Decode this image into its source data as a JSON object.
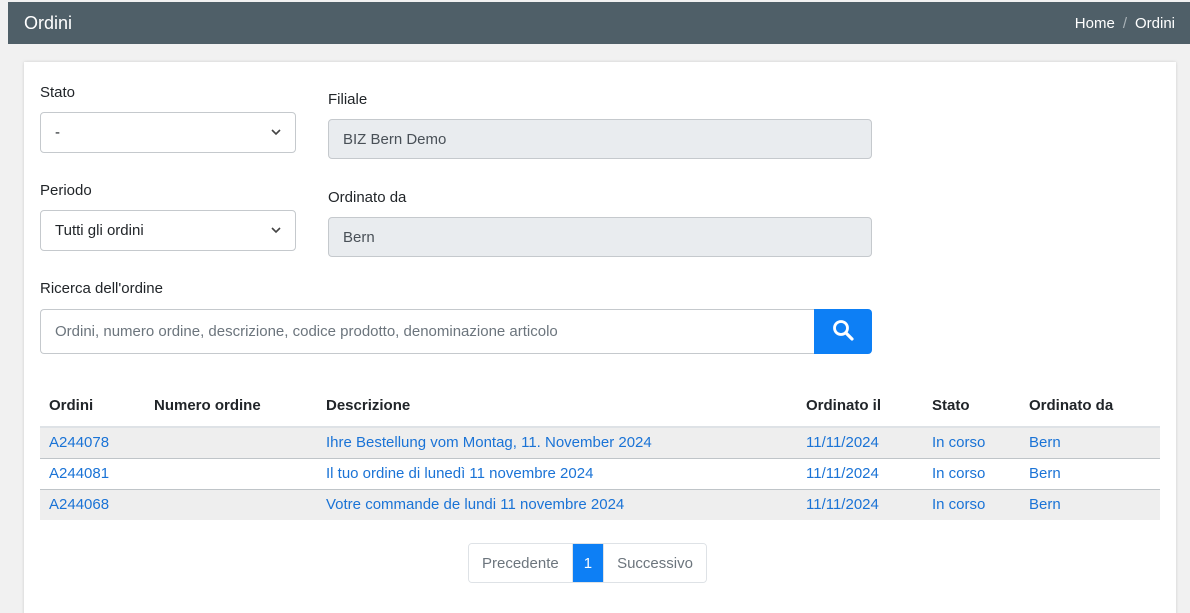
{
  "header": {
    "title": "Ordini",
    "breadcrumb": {
      "home": "Home",
      "separator": "/",
      "current": "Ordini"
    }
  },
  "filters": {
    "stato": {
      "label": "Stato",
      "value": "-"
    },
    "filiale": {
      "label": "Filiale",
      "value": "BIZ Bern Demo"
    },
    "periodo": {
      "label": "Periodo",
      "value": "Tutti gli ordini"
    },
    "ordinato_da": {
      "label": "Ordinato da",
      "value": "Bern"
    },
    "search": {
      "label": "Ricerca dell'ordine",
      "placeholder": "Ordini, numero ordine, descrizione, codice prodotto, denominazione articolo"
    }
  },
  "table": {
    "columns": [
      "Ordini",
      "Numero ordine",
      "Descrizione",
      "Ordinato il",
      "Stato",
      "Ordinato da"
    ],
    "rows": [
      {
        "ordine": "A244078",
        "numero": "",
        "descrizione": "Ihre Bestellung vom Montag, 11. November 2024",
        "data": "11/11/2024",
        "stato": "In corso",
        "ordinato_da": "Bern"
      },
      {
        "ordine": "A244081",
        "numero": "",
        "descrizione": "Il tuo ordine di lunedì 11 novembre 2024",
        "data": "11/11/2024",
        "stato": "In corso",
        "ordinato_da": "Bern"
      },
      {
        "ordine": "A244068",
        "numero": "",
        "descrizione": "Votre commande de lundi 11 novembre 2024",
        "data": "11/11/2024",
        "stato": "In corso",
        "ordinato_da": "Bern"
      }
    ]
  },
  "pagination": {
    "prev": "Precedente",
    "current": "1",
    "next": "Successivo"
  },
  "colors": {
    "header_bg": "#4f5f68",
    "accent": "#0d7ff5",
    "link": "#1a73d6"
  },
  "icons": {
    "search": "search-icon",
    "select": "chevron-down-icon"
  }
}
